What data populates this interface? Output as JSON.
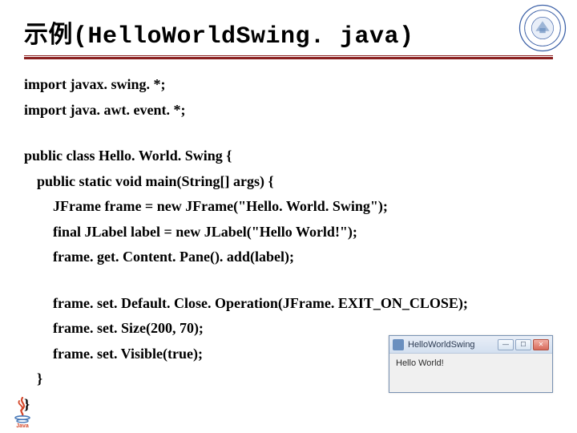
{
  "header": {
    "title_cjk": "示例",
    "title_mono": "(HelloWorldSwing. java)"
  },
  "code": {
    "l1": "import javax. swing. *;",
    "l2": "import java. awt. event. *;",
    "l3": "public class Hello. World. Swing {",
    "l4": "public static void main(String[] args) {",
    "l5": "JFrame frame = new JFrame(\"Hello. World. Swing\");",
    "l6": "final JLabel label = new JLabel(\"Hello World!\");",
    "l7": "frame. get. Content. Pane(). add(label);",
    "l8": "frame. set. Default. Close. Operation(JFrame. EXIT_ON_CLOSE);",
    "l9": "frame. set. Size(200, 70);",
    "l10": "frame. set. Visible(true);",
    "l11": "}",
    "l12": "}"
  },
  "mini_window": {
    "title": "HelloWorldSwing",
    "body": "Hello World!",
    "btn_min": "—",
    "btn_max": "☐",
    "btn_close": "✕"
  }
}
